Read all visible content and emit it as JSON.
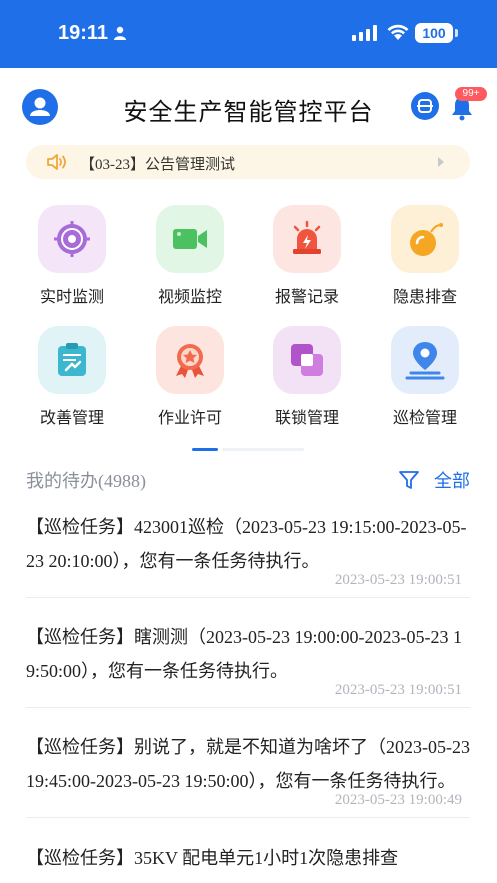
{
  "status_bar": {
    "time": "19:11",
    "battery": "100"
  },
  "header": {
    "title": "安全生产智能管控平台",
    "badge": "99+"
  },
  "notice": {
    "date": "【03-23】",
    "text": "公告管理测试"
  },
  "menu": [
    {
      "label": "实时监测",
      "icon": "target-icon",
      "bg": "#f4e6f8"
    },
    {
      "label": "视频监控",
      "icon": "video-camera-icon",
      "bg": "#e2f6e6"
    },
    {
      "label": "报警记录",
      "icon": "alarm-light-icon",
      "bg": "#fde6e2"
    },
    {
      "label": "隐患排查",
      "icon": "bomb-icon",
      "bg": "#fdf0d6"
    },
    {
      "label": "改善管理",
      "icon": "clipboard-icon",
      "bg": "#e0f4f8"
    },
    {
      "label": "作业许可",
      "icon": "award-ribbon-icon",
      "bg": "#fde4de"
    },
    {
      "label": "联锁管理",
      "icon": "interlock-icon",
      "bg": "#f3e2f6"
    },
    {
      "label": "巡检管理",
      "icon": "location-pin-icon",
      "bg": "#e2ecfb"
    }
  ],
  "todo": {
    "title": "我的待办",
    "count": "(4988)",
    "filter_label": "全部"
  },
  "tasks": [
    {
      "text": "【巡检任务】423001巡检（2023-05-23 19:15:00-2023-05-23 20:10:00），您有一条任务待执行。",
      "time": "2023-05-23 19:00:51"
    },
    {
      "text": "【巡检任务】瞎测测（2023-05-23 19:00:00-2023-05-23 19:50:00），您有一条任务待执行。",
      "time": "2023-05-23 19:00:51"
    },
    {
      "text": "【巡检任务】别说了，就是不知道为啥坏了（2023-05-23 19:45:00-2023-05-23 19:50:00），您有一条任务待执行。",
      "time": "2023-05-23 19:00:49"
    },
    {
      "text": "【巡检任务】35KV 配电单元1小时1次隐患排查",
      "time": ""
    }
  ]
}
